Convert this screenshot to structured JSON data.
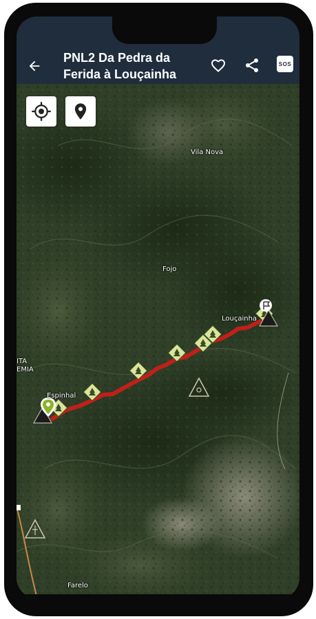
{
  "header": {
    "title_line1": "PNL2 Da Pedra da",
    "title_line2": "Ferida à Louçainha",
    "back_icon": "arrow-left-icon",
    "favorite_icon": "heart-outline-icon",
    "share_icon": "share-icon",
    "sos_label": "SOS"
  },
  "map_tools": {
    "locate_icon": "gps-target-icon",
    "pin_icon": "map-pin-icon"
  },
  "map": {
    "places": {
      "vila_nova": "Vila Nova",
      "fojo": "Fojo",
      "loucainha": "Louçainha",
      "espinhal": "Espinhal",
      "farelo": "Farelo",
      "left_edge_1": "ITA",
      "left_edge_2": "EMIA"
    },
    "colors": {
      "route": "#c0201a",
      "poi_fill": "#d9e59a",
      "header_bg": "#1f2d3d"
    }
  }
}
